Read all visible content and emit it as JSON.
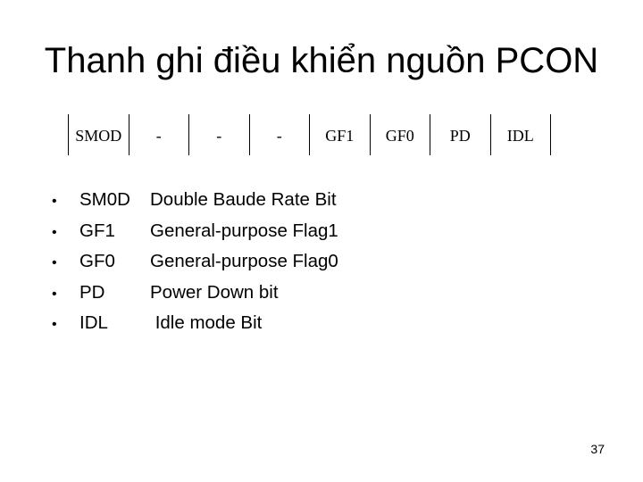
{
  "slide": {
    "title": "Thanh ghi điều khiển nguồn PCON",
    "page_number": "37"
  },
  "register": {
    "name": "PCON",
    "bits": [
      {
        "label": "SMOD"
      },
      {
        "label": "-"
      },
      {
        "label": "-"
      },
      {
        "label": "-"
      },
      {
        "label": "GF1"
      },
      {
        "label": "GF0"
      },
      {
        "label": "PD"
      },
      {
        "label": "IDL"
      }
    ]
  },
  "bullets": [
    {
      "bullet": "•",
      "term": "SM0D",
      "description": "Double Baude Rate Bit"
    },
    {
      "bullet": "•",
      "term": "GF1",
      "description": "General-purpose Flag1"
    },
    {
      "bullet": "•",
      "term": "GF0",
      "description": "General-purpose Flag0"
    },
    {
      "bullet": "•",
      "term": "PD",
      "description": "Power Down bit"
    },
    {
      "bullet": "•",
      "term": "IDL",
      "description": " Idle mode Bit"
    }
  ]
}
